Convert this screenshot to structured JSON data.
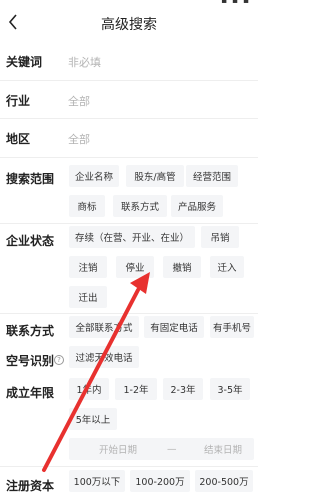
{
  "page": {
    "title": "高级搜索"
  },
  "fields": {
    "keyword": {
      "label": "关键词",
      "placeholder": "非必填"
    },
    "industry": {
      "label": "行业",
      "value": "全部"
    },
    "region": {
      "label": "地区",
      "value": "全部"
    }
  },
  "scope": {
    "label": "搜索范围",
    "options": [
      "企业名称",
      "股东/高管",
      "经营范围",
      "商标",
      "联系方式",
      "产品服务"
    ]
  },
  "status": {
    "label": "企业状态",
    "options": [
      "存续（在营、开业、在业）",
      "吊销",
      "注销",
      "停业",
      "撤销",
      "迁入",
      "迁出"
    ]
  },
  "contact": {
    "label": "联系方式",
    "options": [
      "全部联系方式",
      "有固定电话",
      "有手机号"
    ]
  },
  "empty_number": {
    "label": "空号识别",
    "options": [
      "过滤无效电话"
    ]
  },
  "founded": {
    "label": "成立年限",
    "options": [
      "1年内",
      "1-2年",
      "2-3年",
      "3-5年",
      "5年以上"
    ],
    "start_placeholder": "开始日期",
    "separator": "—",
    "end_placeholder": "结束日期"
  },
  "capital": {
    "label": "注册资本",
    "options": [
      "100万以下",
      "100-200万",
      "200-500万"
    ]
  },
  "colors": {
    "chip_bg": "#f4f5f7",
    "arrow": "#e8312f",
    "placeholder": "#b3b3b3"
  }
}
